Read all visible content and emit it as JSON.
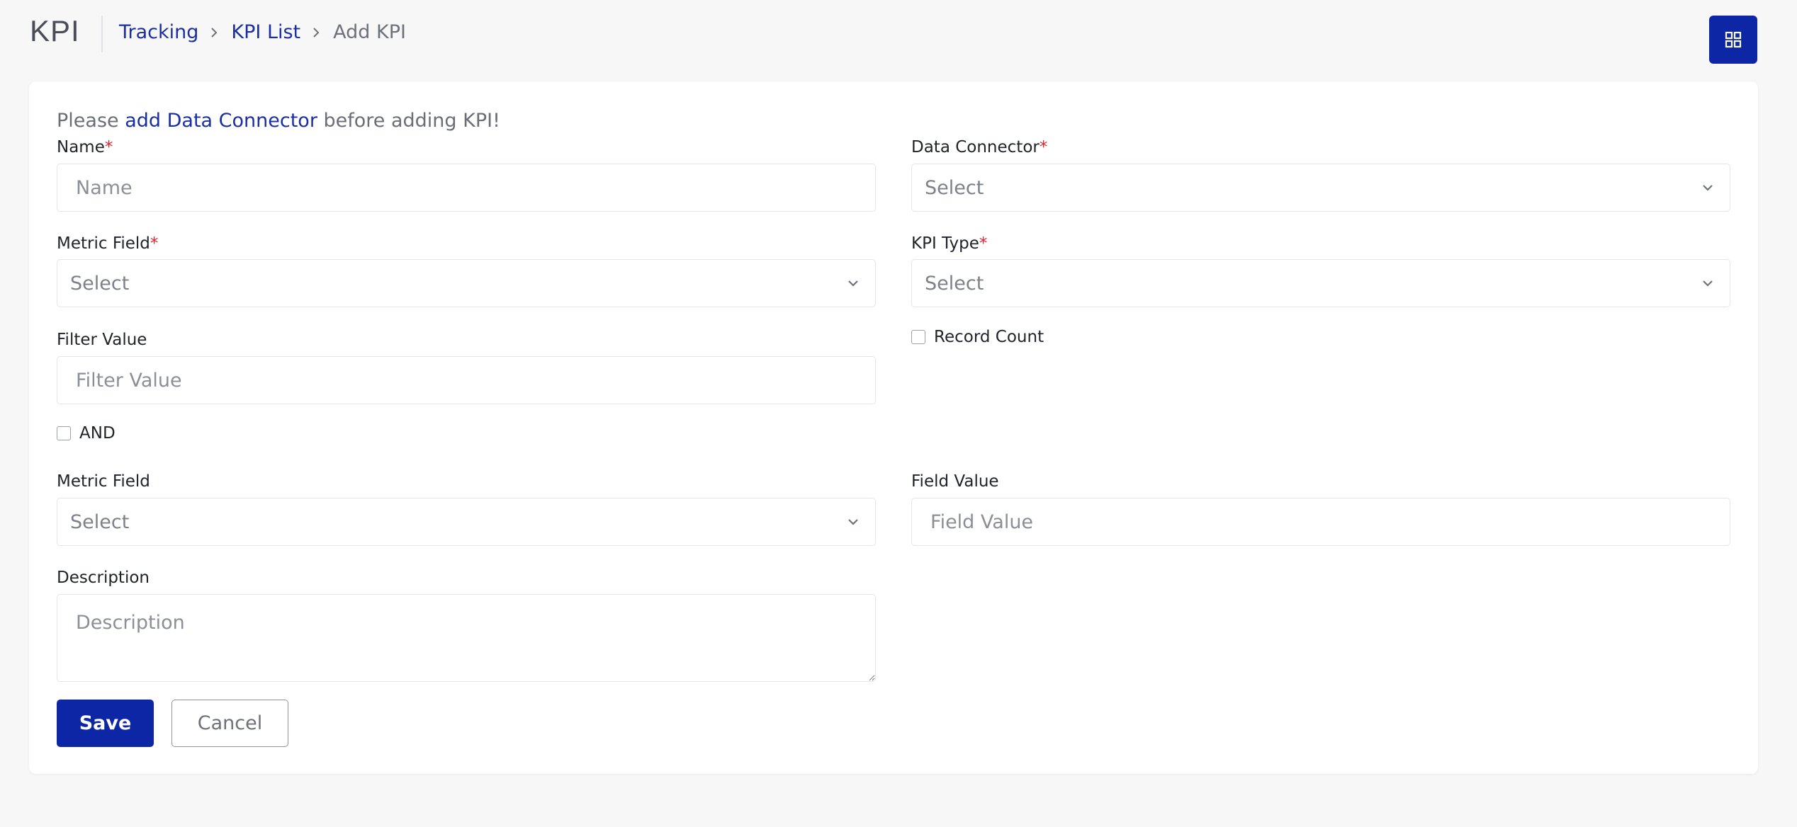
{
  "header": {
    "title": "KPI",
    "breadcrumb": [
      {
        "label": "Tracking",
        "link": true
      },
      {
        "label": "KPI List",
        "link": true
      },
      {
        "label": "Add KPI",
        "link": false
      }
    ],
    "apps_icon": "grid-icon"
  },
  "notice": {
    "prefix": "Please ",
    "link": "add Data Connector",
    "suffix": " before adding KPI!"
  },
  "form": {
    "name": {
      "label": "Name",
      "required": "*",
      "placeholder": "Name",
      "value": ""
    },
    "data_connector": {
      "label": "Data Connector",
      "required": "*",
      "value": "Select"
    },
    "metric_field": {
      "label": "Metric Field",
      "required": "*",
      "value": "Select"
    },
    "kpi_type": {
      "label": "KPI Type",
      "required": "*",
      "value": "Select"
    },
    "filter_value": {
      "label": "Filter Value",
      "placeholder": "Filter Value",
      "value": ""
    },
    "record_count": {
      "label": "Record Count",
      "checked": false
    },
    "and_toggle": {
      "label": "AND",
      "checked": false
    },
    "metric_field_2": {
      "label": "Metric Field",
      "value": "Select"
    },
    "field_value": {
      "label": "Field Value",
      "placeholder": "Field Value",
      "value": ""
    },
    "description": {
      "label": "Description",
      "placeholder": "Description",
      "value": ""
    }
  },
  "actions": {
    "save_label": "Save",
    "cancel_label": "Cancel"
  },
  "colors": {
    "primary": "#0d26a6",
    "link": "#1a2fa3",
    "required": "#e0252e",
    "background": "#f7f7f8",
    "card": "#ffffff"
  }
}
